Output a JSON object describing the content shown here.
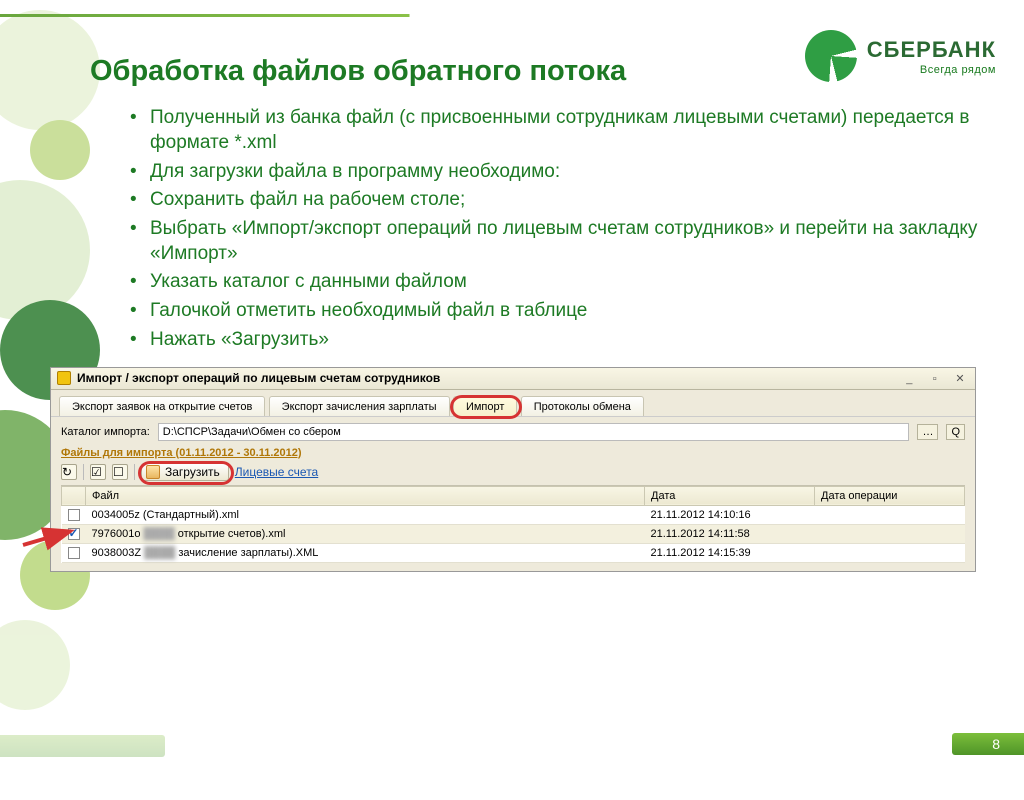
{
  "brand": {
    "name": "СБЕРБАНК",
    "tagline": "Всегда рядом"
  },
  "slide": {
    "title": "Обработка файлов обратного потока",
    "bullets": [
      "Полученный из банка файл (с присвоенными сотрудникам лицевыми счетами) передается в формате *.xml",
      "Для загрузки файла в программу необходимо:",
      "Сохранить файл на рабочем столе;",
      "Выбрать «Импорт/экспорт операций по лицевым счетам сотрудников» и перейти на закладку «Импорт»",
      "Указать каталог с данными файлом",
      "Галочкой отметить необходимый файл в таблице",
      "Нажать «Загрузить»"
    ],
    "page_number": "8"
  },
  "app": {
    "window_title": "Импорт / экспорт операций по лицевым счетам сотрудников",
    "tabs": [
      "Экспорт заявок на открытие счетов",
      "Экспорт зачисления зарплаты",
      "Импорт",
      "Протоколы обмена"
    ],
    "catalog_label": "Каталог импорта:",
    "catalog_path": "D:\\СПСР\\Задачи\\Обмен со сбером",
    "files_label": "Файлы для импорта   (01.11.2012 - 30.11.2012)",
    "load_button": "Загрузить",
    "accounts_link": "Лицевые счета",
    "columns": {
      "file": "Файл",
      "date": "Дата",
      "op_date": "Дата операции"
    },
    "rows": [
      {
        "checked": false,
        "name": "0034005z (Стандартный).xml",
        "date": "21.11.2012 14:10:16",
        "op": ""
      },
      {
        "checked": true,
        "name_a": "7976001o",
        "name_b": "открытие счетов).xml",
        "date": "21.11.2012 14:11:58",
        "op": ""
      },
      {
        "checked": false,
        "name_a": "9038003Z",
        "name_b": "зачисление зарплаты).XML",
        "date": "21.11.2012 14:15:39",
        "op": ""
      }
    ]
  }
}
